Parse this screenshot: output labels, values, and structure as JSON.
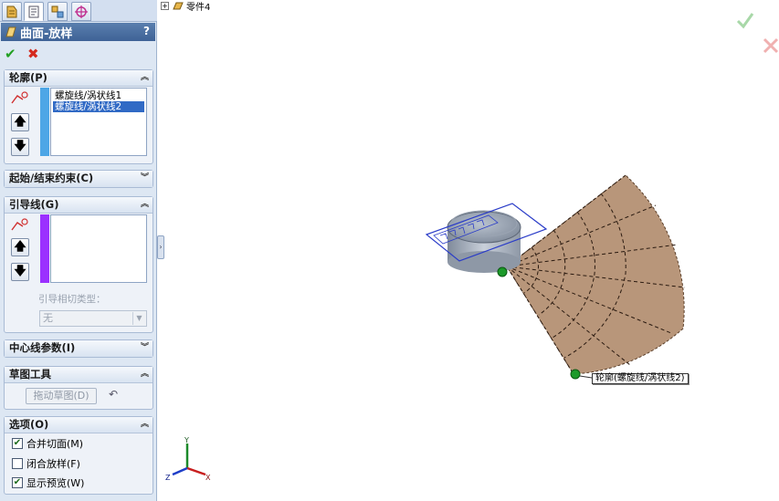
{
  "feature": {
    "title": "曲面-放样",
    "help": "?"
  },
  "profiles": {
    "header": "轮廓(P)",
    "items": [
      "螺旋线/涡状线1",
      "螺旋线/涡状线2"
    ],
    "selected_index": 1
  },
  "start_end": {
    "header": "起始/结束约束(C)"
  },
  "guides": {
    "header": "引导线(G)",
    "items": [],
    "tangency_label": "引导相切类型：",
    "tangency_value": "无"
  },
  "centerline": {
    "header": "中心线参数(I)"
  },
  "sketch_tools": {
    "header": "草图工具",
    "drag_button": "拖动草图(D)"
  },
  "options": {
    "header": "选项(O)",
    "checkboxes": [
      {
        "label": "合并切面(M)",
        "checked": true
      },
      {
        "label": "闭合放样(F)",
        "checked": false
      },
      {
        "label": "显示预览(W)",
        "checked": true
      }
    ]
  },
  "tree": {
    "part_name": "零件4"
  },
  "viewport": {
    "callout": "轮廓(螺旋线/涡状线2)",
    "triad_labels": {
      "x": "X",
      "y": "Y",
      "z": "Z"
    }
  },
  "colors": {
    "profile_bar": "#4da6e6",
    "guide_bar": "#9b30ff",
    "surface_fill": "#b8967a",
    "accent": "#3e6296"
  }
}
